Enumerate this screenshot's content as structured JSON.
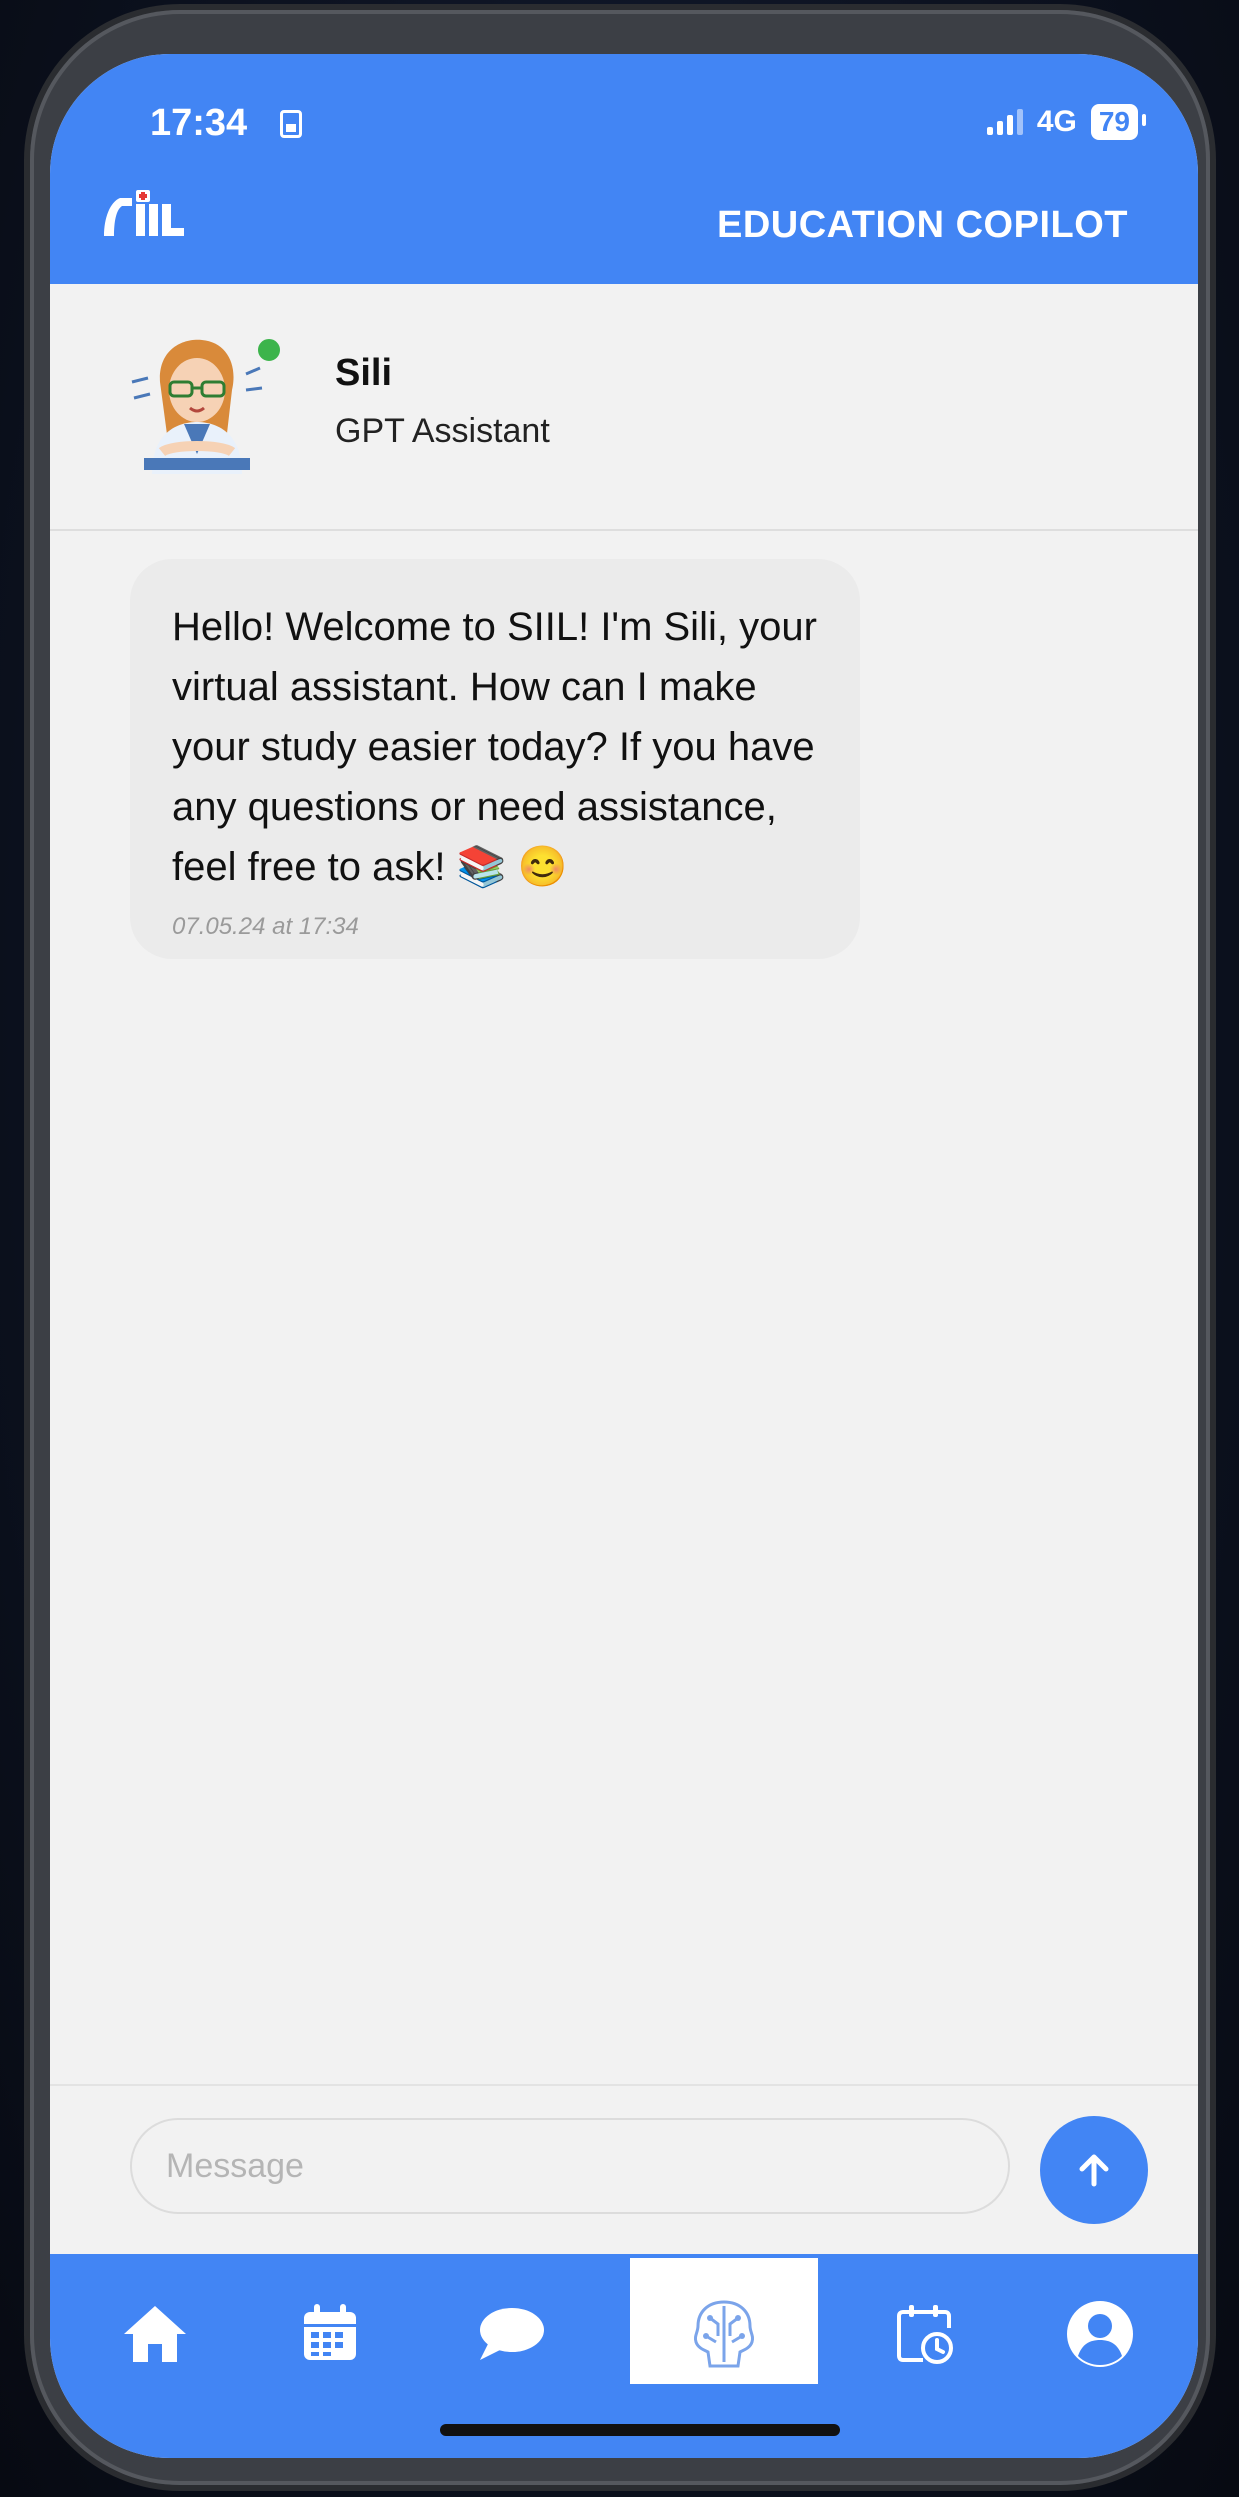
{
  "status": {
    "time": "17:34",
    "network": "4G",
    "battery": "79"
  },
  "header": {
    "logo_alt": "SIIL",
    "title": "EDUCATION COPILOT"
  },
  "contact": {
    "name": "Sili",
    "subtitle": "GPT Assistant",
    "online": true
  },
  "messages": [
    {
      "text": "Hello! Welcome to SIIL! I'm Sili, your virtual assistant. How can I make your study easier today? If you have any questions or need assistance, feel free to ask! 📚 😊",
      "time": "07.05.24 at 17:34"
    }
  ],
  "composer": {
    "placeholder": "Message",
    "send_icon": "arrow-up-icon"
  },
  "nav": [
    {
      "icon": "home-icon"
    },
    {
      "icon": "calendar-icon"
    },
    {
      "icon": "chat-bubble-icon"
    },
    {
      "icon": "ai-brain-icon",
      "active": true
    },
    {
      "icon": "schedule-clock-icon"
    },
    {
      "icon": "profile-icon"
    }
  ],
  "colors": {
    "primary": "#4285f4",
    "background": "#f2f2f2",
    "bubble": "#ebebeb",
    "online": "#3cb44b"
  }
}
